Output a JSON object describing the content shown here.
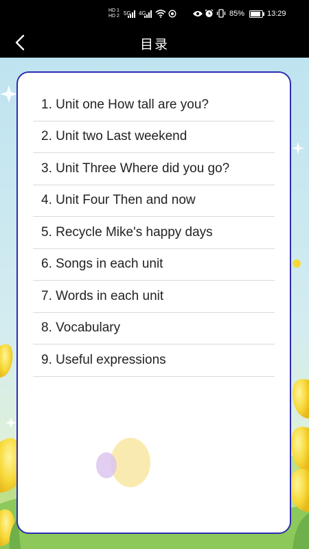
{
  "status_bar": {
    "sim1_label": "HD 1",
    "sim2_label": "HD 2",
    "network_1": "5G",
    "network_2": "4G",
    "battery_text": "85%",
    "battery_level": 0.85,
    "time": "13:29"
  },
  "nav": {
    "title": "目录",
    "back_icon": "chevron-left-icon"
  },
  "toc": {
    "items": [
      {
        "label": "1. Unit one How tall are you?"
      },
      {
        "label": "2. Unit two Last weekend"
      },
      {
        "label": "3. Unit Three Where did you go?"
      },
      {
        "label": "4. Unit Four Then and now"
      },
      {
        "label": "5. Recycle Mike's happy days"
      },
      {
        "label": "6. Songs in each unit"
      },
      {
        "label": "7. Words in each unit"
      },
      {
        "label": "8. Vocabulary"
      },
      {
        "label": "9. Useful expressions"
      }
    ]
  },
  "colors": {
    "card_border": "#2c2cb0",
    "bar_background": "#000000",
    "sky_top": "#bfe3f0",
    "sky_bottom": "#e6f3c8"
  }
}
